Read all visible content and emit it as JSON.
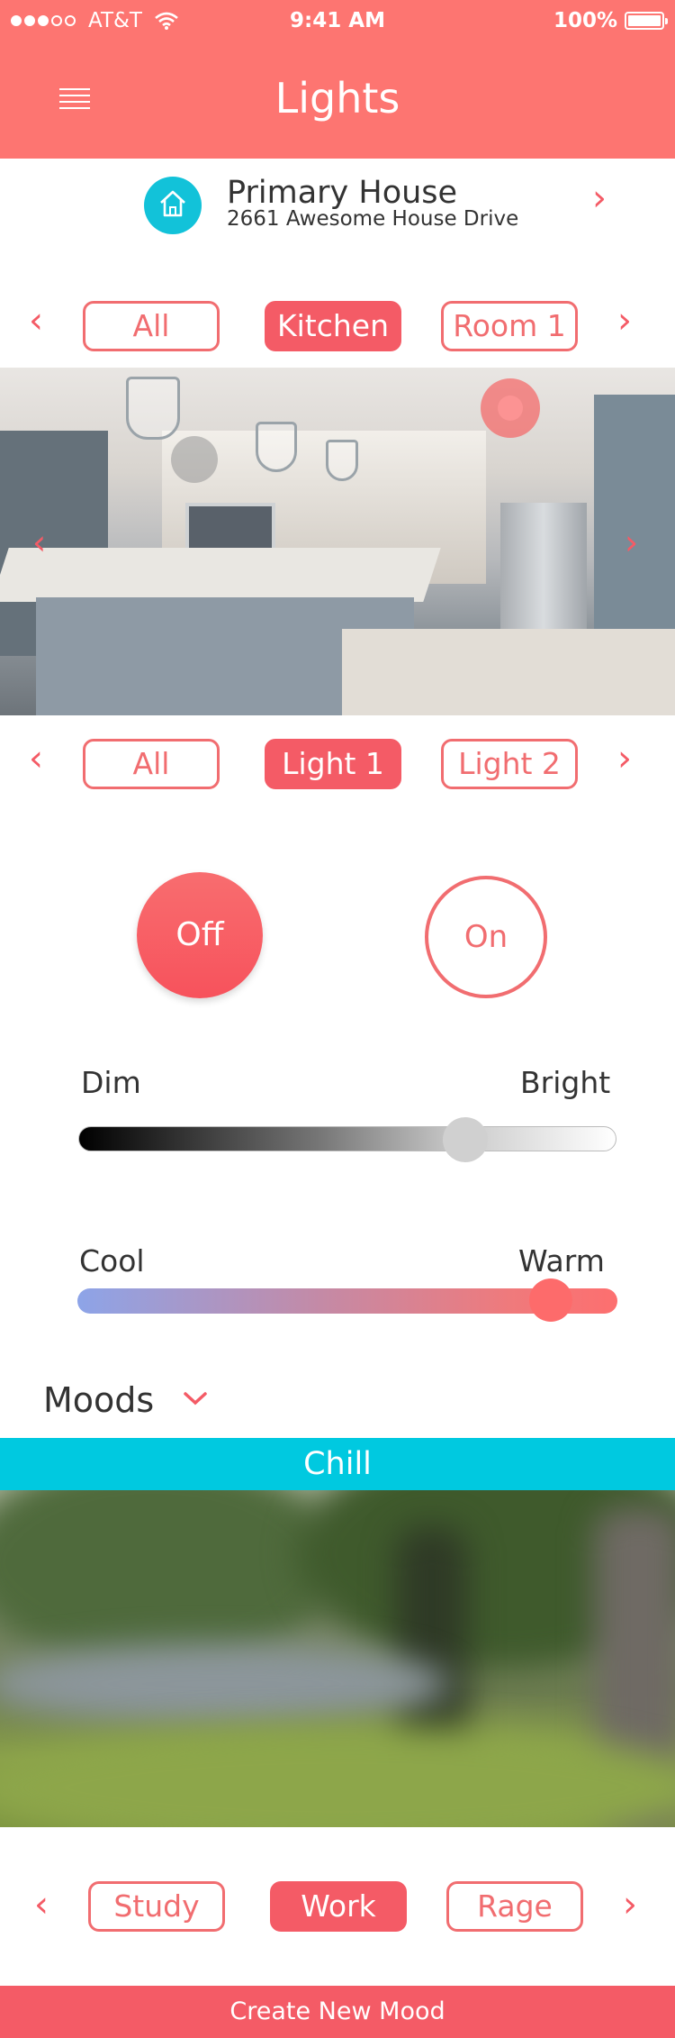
{
  "status_bar": {
    "carrier": "AT&T",
    "time": "9:41 AM",
    "battery": "100%"
  },
  "header": {
    "title": "Lights",
    "menu_icon": "hamburger-icon"
  },
  "house": {
    "name": "Primary House",
    "address": "2661 Awesome House Drive",
    "icon": "home-icon"
  },
  "rooms": {
    "items": [
      "All",
      "Kitchen",
      "Room 1"
    ],
    "active_index": 1
  },
  "lights": {
    "items": [
      "All",
      "Light 1",
      "Light 2"
    ],
    "active_index": 1
  },
  "power": {
    "off_label": "Off",
    "on_label": "On",
    "selected": "Off"
  },
  "brightness": {
    "min_label": "Dim",
    "max_label": "Bright",
    "value": 0.72
  },
  "temperature": {
    "min_label": "Cool",
    "max_label": "Warm",
    "value": 0.88
  },
  "moods": {
    "heading": "Moods",
    "current": "Chill",
    "items": [
      "Study",
      "Work",
      "Rage"
    ],
    "active_index": 1
  },
  "create_button": "Create New Mood",
  "colors": {
    "accent": "#f45b66",
    "header": "#fd7571",
    "mood_banner": "#00c9e0",
    "house_icon": "#12c2d9"
  }
}
